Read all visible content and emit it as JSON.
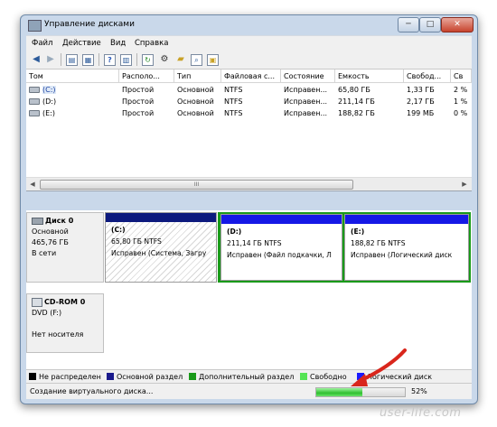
{
  "window": {
    "title": "Управление дисками",
    "min": "─",
    "max": "□",
    "close": "✕"
  },
  "menu": [
    "Файл",
    "Действие",
    "Вид",
    "Справка"
  ],
  "volumes": {
    "columns": [
      "Том",
      "Располо...",
      "Тип",
      "Файловая с...",
      "Состояние",
      "Емкость",
      "Свобод...",
      "Св"
    ],
    "rows": [
      [
        "(C:)",
        "Простой",
        "Основной",
        "NTFS",
        "Исправен...",
        "65,80 ГБ",
        "1,33 ГБ",
        "2 %"
      ],
      [
        "(D:)",
        "Простой",
        "Основной",
        "NTFS",
        "Исправен...",
        "211,14 ГБ",
        "2,17 ГБ",
        "1 %"
      ],
      [
        "(E:)",
        "Простой",
        "Основной",
        "NTFS",
        "Исправен...",
        "188,82 ГБ",
        "199 МБ",
        "0 %"
      ]
    ],
    "scroll_thumb": "III"
  },
  "disk0": {
    "name": "Диск 0",
    "type": "Основной",
    "size": "465,76 ГБ",
    "state": "В сети",
    "partitions": [
      {
        "name": "(C:)",
        "size": "65,80 ГБ NTFS",
        "status": "Исправен (Система, Загру"
      },
      {
        "name": "(D:)",
        "size": "211,14 ГБ NTFS",
        "status": "Исправен (Файл подкачки, Л"
      },
      {
        "name": "(E:)",
        "size": "188,82 ГБ NTFS",
        "status": "Исправен (Логический диск"
      }
    ]
  },
  "cdrom0": {
    "name": "CD-ROM 0",
    "type": "DVD (F:)",
    "state": "Нет носителя"
  },
  "legend": [
    {
      "label": "Не распределен",
      "color": "#000000"
    },
    {
      "label": "Основной раздел",
      "color": "#1a1a8c"
    },
    {
      "label": "Дополнительный раздел",
      "color": "#199a19"
    },
    {
      "label": "Свободно",
      "color": "#55e455"
    },
    {
      "label": "Логический диск",
      "color": "#1a1aff"
    }
  ],
  "status": {
    "text": "Создание виртуального диска...",
    "percent_label": "52%",
    "progress": 0.52
  },
  "watermark": "user-life.com",
  "colors": {
    "primary_bar": "#0d1a7e",
    "logical_bar": "#1518e6",
    "extended_border": "#199a19",
    "arrow": "#d9261c"
  }
}
